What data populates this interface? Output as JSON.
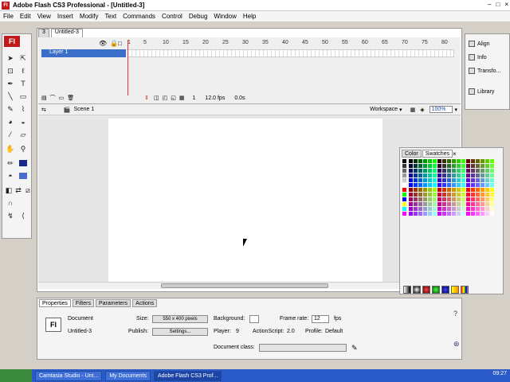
{
  "window": {
    "title": "Adobe Flash CS3 Professional - [Untitled-3]",
    "app_badge": "Fl"
  },
  "menu": [
    "File",
    "Edit",
    "View",
    "Insert",
    "Modify",
    "Text",
    "Commands",
    "Control",
    "Debug",
    "Window",
    "Help"
  ],
  "doc_tabs": [
    {
      "label": "3"
    },
    {
      "label": "Untitled-3"
    }
  ],
  "timeline": {
    "frame_numbers": [
      "1",
      "5",
      "10",
      "15",
      "20",
      "25",
      "30",
      "35",
      "40",
      "45",
      "50",
      "55",
      "60",
      "65",
      "70",
      "75",
      "80"
    ],
    "layer_name": "Layer 1",
    "current_frame": "1",
    "fps": "12.0 fps",
    "time": "0.0s"
  },
  "edit_bar": {
    "scene": "Scene 1",
    "workspace": "Workspace",
    "zoom": "100%"
  },
  "right_dock": [
    {
      "label": "Align"
    },
    {
      "label": "Info"
    },
    {
      "label": "Transfo..."
    },
    {
      "label": "Library"
    }
  ],
  "swatches_panel": {
    "tabs": [
      {
        "label": "Color"
      },
      {
        "label": "Swatches"
      }
    ]
  },
  "properties": {
    "tabs": [
      {
        "label": "Properties"
      },
      {
        "label": "Filters"
      },
      {
        "label": "Parameters"
      },
      {
        "label": "Actions"
      }
    ],
    "doc_icon": "Fl",
    "doc_type": "Document",
    "doc_name": "Untitled-3",
    "size_label": "Size:",
    "size_value": "550 x 400 pixels",
    "publish_label": "Publish:",
    "settings_button": "Settings...",
    "background_label": "Background:",
    "frame_rate_label": "Frame rate:",
    "frame_rate_value": "12",
    "fps_unit": "fps",
    "player_label": "Player:",
    "player_value": "9",
    "actionscript_label": "ActionScript:",
    "actionscript_value": "2.0",
    "profile_label": "Profile:",
    "profile_value": "Default",
    "document_class_label": "Document class:"
  },
  "taskbar": {
    "tasks": [
      {
        "label": "Camtasia Studio - Unt..."
      },
      {
        "label": "My Documents"
      },
      {
        "label": "Adobe Flash CS3 Prof..."
      }
    ],
    "clock": "09:27"
  }
}
